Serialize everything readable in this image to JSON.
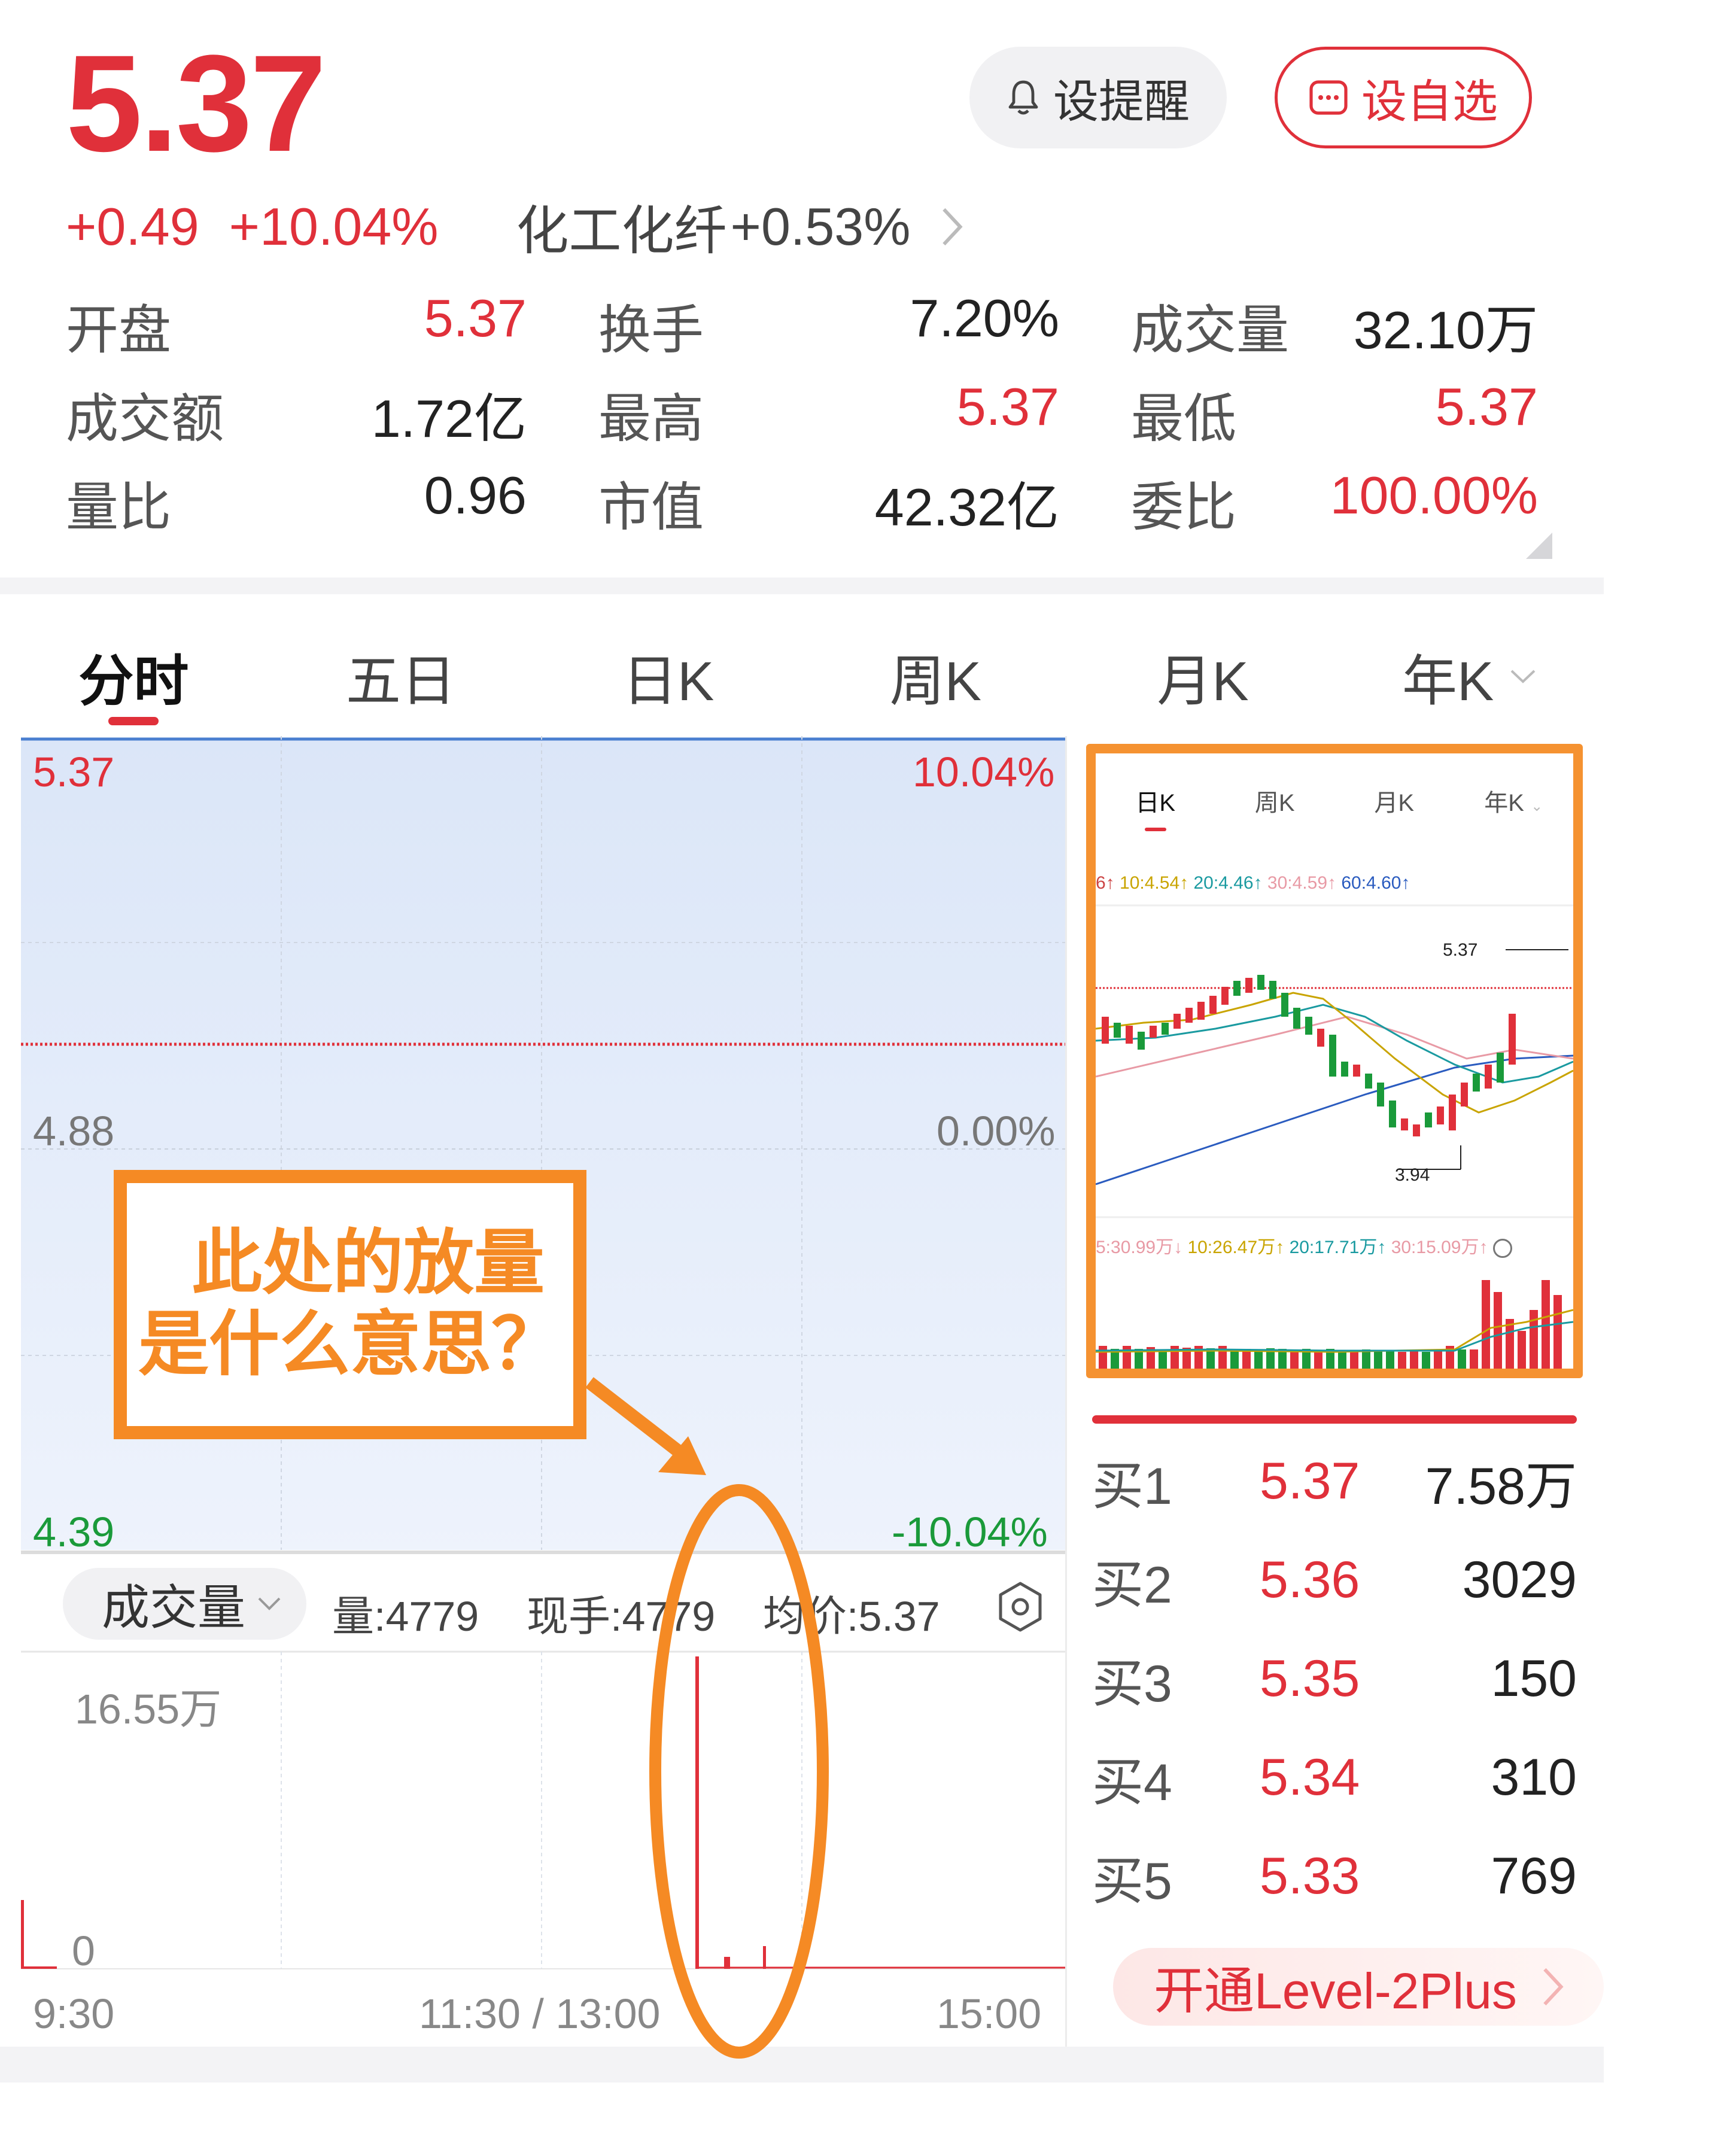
{
  "header": {
    "price": "5.37",
    "alert_label": "设提醒",
    "watch_label": "设自选",
    "change_abs": "+0.49",
    "change_pct": "+10.04%",
    "sector_name": "化工化纤",
    "sector_change": "+0.53%"
  },
  "stats": [
    [
      {
        "label": "开盘",
        "value": "5.37",
        "color": "red"
      },
      {
        "label": "换手",
        "value": "7.20%",
        "color": "black"
      },
      {
        "label": "成交量",
        "value": "32.10万",
        "color": "black"
      }
    ],
    [
      {
        "label": "成交额",
        "value": "1.72亿",
        "color": "black"
      },
      {
        "label": "最高",
        "value": "5.37",
        "color": "red"
      },
      {
        "label": "最低",
        "value": "5.37",
        "color": "red"
      }
    ],
    [
      {
        "label": "量比",
        "value": "0.96",
        "color": "black"
      },
      {
        "label": "市值",
        "value": "42.32亿",
        "color": "black"
      },
      {
        "label": "委比",
        "value": "100.00%",
        "color": "red"
      }
    ]
  ],
  "tabs": [
    "分时",
    "五日",
    "日K",
    "周K",
    "月K",
    "年K"
  ],
  "active_tab": 0,
  "chart": {
    "price_top": "5.37",
    "pct_top": "10.04%",
    "price_mid": "4.88",
    "pct_mid": "0.00%",
    "price_bottom": "4.39",
    "pct_bottom": "-10.04%",
    "time_start": "9:30",
    "time_mid": "11:30 / 13:00",
    "time_end": "15:00",
    "volume_max_label": "16.55万",
    "volume_zero_label": "0"
  },
  "volume_bar": {
    "selector": "成交量",
    "vol_label": "量:",
    "vol_value": "4779",
    "hand_label": "现手:",
    "hand_value": "4779",
    "avg_label": "均价:",
    "avg_value": "5.37"
  },
  "mini_chart": {
    "tabs": [
      "日K",
      "周K",
      "月K",
      "年K"
    ],
    "ma_items": [
      {
        "text": "6↑",
        "color": "#c44"
      },
      {
        "text": "10:4.54↑",
        "color": "#c9a400"
      },
      {
        "text": "20:4.46↑",
        "color": "#1a9aa0"
      },
      {
        "text": "30:4.59↑",
        "color": "#e89aa5"
      },
      {
        "text": "60:4.60↑",
        "color": "#2a5bbf"
      }
    ],
    "high_label": "5.37",
    "low_label": "3.94",
    "vol_ma_items": [
      {
        "text": "5:30.99万↓",
        "color": "#e89aa5"
      },
      {
        "text": "10:26.47万↑",
        "color": "#c9a400"
      },
      {
        "text": "20:17.71万↑",
        "color": "#1a9aa0"
      },
      {
        "text": "30:15.09万↑",
        "color": "#e89aa5"
      }
    ]
  },
  "order_book": [
    {
      "label": "买1",
      "price": "5.37",
      "volume": "7.58万"
    },
    {
      "label": "买2",
      "price": "5.36",
      "volume": "3029"
    },
    {
      "label": "买3",
      "price": "5.35",
      "volume": "150"
    },
    {
      "label": "买4",
      "price": "5.34",
      "volume": "310"
    },
    {
      "label": "买5",
      "price": "5.33",
      "volume": "769"
    }
  ],
  "level2_label": "开通Level-2Plus",
  "annotation": {
    "line1": "此处的放量",
    "line2": "是什么意思？"
  },
  "colors": {
    "up": "#e0303a",
    "down": "#1a9a3a",
    "annotation": "#f58a24"
  }
}
